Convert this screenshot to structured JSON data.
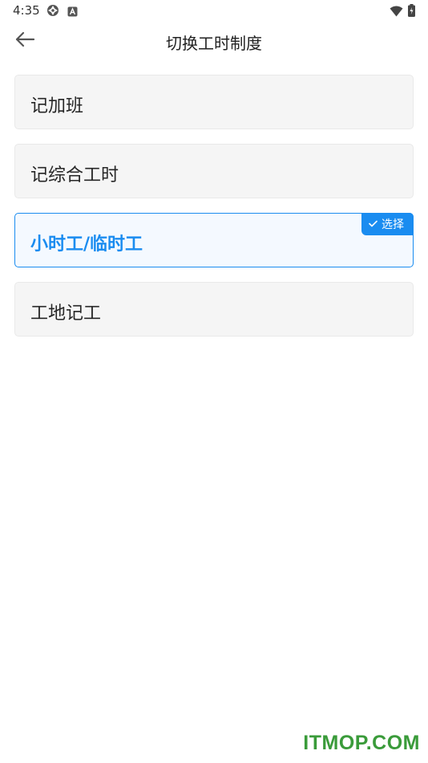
{
  "status_bar": {
    "time": "4:35",
    "left_icons": [
      "camera-shutter-icon",
      "a-box-icon"
    ],
    "right_icons": [
      "wifi-icon",
      "battery-icon"
    ]
  },
  "header": {
    "title": "切换工时制度",
    "back_icon": "arrow-left-icon"
  },
  "options": [
    {
      "label": "记加班",
      "selected": false
    },
    {
      "label": "记综合工时",
      "selected": false
    },
    {
      "label": "小时工/临时工",
      "selected": true,
      "badge": "选择"
    },
    {
      "label": "工地记工",
      "selected": false
    }
  ],
  "colors": {
    "accent": "#1a8cf0",
    "option_bg": "#f5f5f5",
    "selected_bg": "#f4f9ff",
    "watermark": "#3a9b3a"
  },
  "watermark": "ITMOP.COM"
}
